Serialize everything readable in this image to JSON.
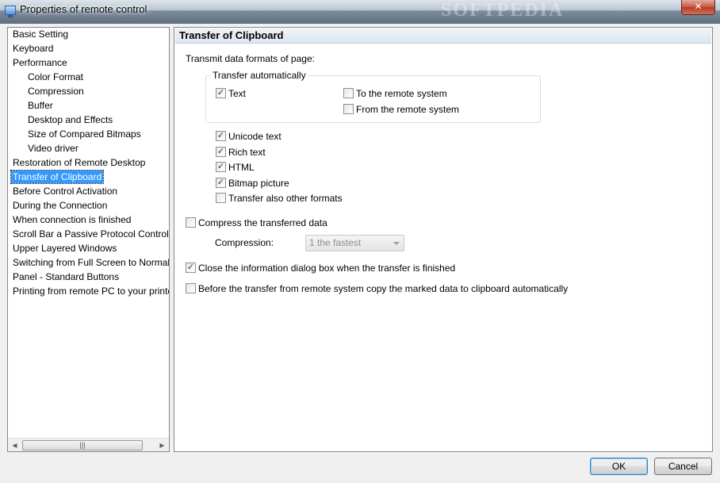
{
  "window": {
    "title": "Properties of remote control",
    "watermark": "SOFTPEDIA",
    "close_label": "✕"
  },
  "tree": {
    "items": [
      {
        "label": "Basic Setting",
        "level": 0
      },
      {
        "label": "Keyboard",
        "level": 0
      },
      {
        "label": "Performance",
        "level": 0
      },
      {
        "label": "Color Format",
        "level": 1
      },
      {
        "label": "Compression",
        "level": 1
      },
      {
        "label": "Buffer",
        "level": 1
      },
      {
        "label": "Desktop and Effects",
        "level": 1
      },
      {
        "label": "Size of Compared Bitmaps",
        "level": 1
      },
      {
        "label": "Video driver",
        "level": 1
      },
      {
        "label": "Restoration of Remote Desktop",
        "level": 0
      },
      {
        "label": "Transfer of Clipboard",
        "level": 0,
        "selected": true
      },
      {
        "label": "Before Control Activation",
        "level": 0
      },
      {
        "label": "During the Connection",
        "level": 0
      },
      {
        "label": "When connection is finished",
        "level": 0
      },
      {
        "label": "Scroll Bar a Passive Protocol Control",
        "level": 0
      },
      {
        "label": "Upper Layered Windows",
        "level": 0
      },
      {
        "label": "Switching from Full Screen to Normal",
        "level": 0
      },
      {
        "label": "Panel - Standard Buttons",
        "level": 0
      },
      {
        "label": "Printing from remote PC to your printer",
        "level": 0
      }
    ],
    "scroll_left": "◀",
    "scroll_right": "▶",
    "scroll_grip": "|||"
  },
  "panel": {
    "header": "Transfer of Clipboard",
    "intro": "Transmit data formats of page:",
    "group_label": "Transfer automatically",
    "text_label": "Text",
    "text_checked": true,
    "to_remote_label": "To the remote system",
    "to_remote_checked": false,
    "from_remote_label": "From the remote system",
    "from_remote_checked": false,
    "formats": [
      {
        "label": "Unicode text",
        "checked": true
      },
      {
        "label": "Rich text",
        "checked": true
      },
      {
        "label": "HTML",
        "checked": true
      },
      {
        "label": "Bitmap picture",
        "checked": true
      },
      {
        "label": "Transfer also other formats",
        "checked": false
      }
    ],
    "compress_label": "Compress the transferred data",
    "compress_checked": false,
    "compression_label": "Compression:",
    "compression_value": "1 the fastest",
    "close_dialog_label": "Close the information dialog box when the transfer is finished",
    "close_dialog_checked": true,
    "auto_copy_label": "Before the transfer from remote system copy the marked data to clipboard automatically",
    "auto_copy_checked": false
  },
  "buttons": {
    "ok": "OK",
    "cancel": "Cancel"
  },
  "checkmark": "✓"
}
